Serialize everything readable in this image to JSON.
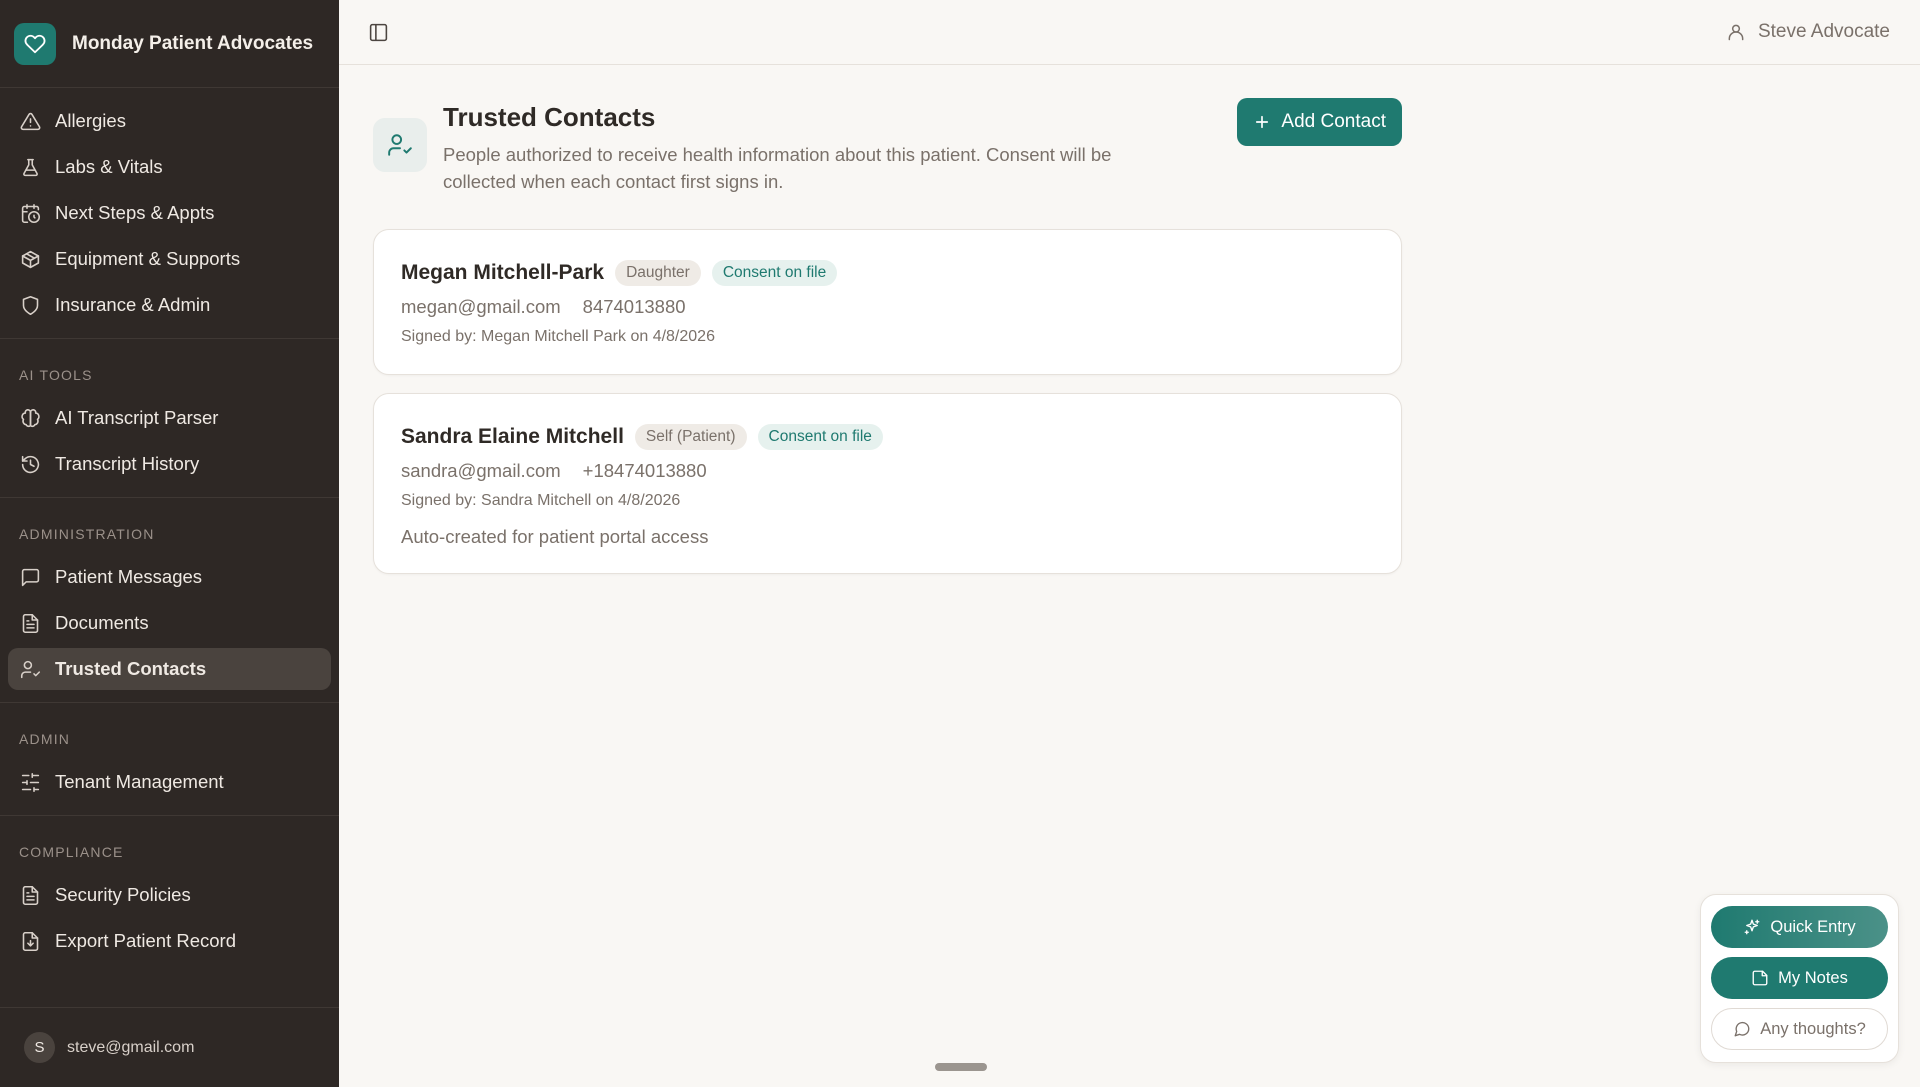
{
  "brand": {
    "title": "Monday Patient Advocates",
    "logo_icon": "heart-icon",
    "accent": "#1f7a70"
  },
  "nav": {
    "main_items": [
      {
        "label": "Allergies",
        "icon": "alert-triangle-icon"
      },
      {
        "label": "Labs & Vitals",
        "icon": "flask-icon"
      },
      {
        "label": "Next Steps & Appts",
        "icon": "calendar-clock-icon"
      },
      {
        "label": "Equipment & Supports",
        "icon": "package-icon"
      },
      {
        "label": "Insurance & Admin",
        "icon": "shield-icon"
      }
    ],
    "ai_tools": {
      "label": "AI TOOLS",
      "items": [
        {
          "label": "AI Transcript Parser",
          "icon": "brain-icon"
        },
        {
          "label": "Transcript History",
          "icon": "history-icon"
        }
      ]
    },
    "administration": {
      "label": "ADMINISTRATION",
      "items": [
        {
          "label": "Patient Messages",
          "icon": "message-square-icon"
        },
        {
          "label": "Documents",
          "icon": "file-text-icon"
        },
        {
          "label": "Trusted Contacts",
          "icon": "user-check-icon",
          "active": true
        }
      ]
    },
    "admin": {
      "label": "ADMIN",
      "items": [
        {
          "label": "Tenant Management",
          "icon": "sliders-icon"
        }
      ]
    },
    "compliance": {
      "label": "COMPLIANCE",
      "items": [
        {
          "label": "Security Policies",
          "icon": "file-text-icon"
        },
        {
          "label": "Export Patient Record",
          "icon": "file-download-icon"
        }
      ]
    }
  },
  "footer": {
    "avatar_initial": "S",
    "email": "steve@gmail.com"
  },
  "topbar": {
    "user_name": "Steve Advocate"
  },
  "page": {
    "title": "Trusted Contacts",
    "description": "People authorized to receive health information about this patient. Consent will be collected when each contact first signs in.",
    "add_button_label": "Add Contact"
  },
  "contacts": [
    {
      "name": "Megan Mitchell-Park",
      "relationship": "Daughter",
      "consent": "Consent on file",
      "email": "megan@gmail.com",
      "phone": "8474013880",
      "signed": "Signed by: Megan Mitchell Park on 4/8/2026"
    },
    {
      "name": "Sandra Elaine Mitchell",
      "relationship": "Self (Patient)",
      "consent": "Consent on file",
      "email": "sandra@gmail.com",
      "phone": "+18474013880",
      "signed": "Signed by: Sandra Mitchell on 4/8/2026",
      "note": "Auto-created for patient portal access"
    }
  ],
  "floating": {
    "quick_entry": "Quick Entry",
    "my_notes": "My Notes",
    "any_thoughts": "Any thoughts?"
  }
}
